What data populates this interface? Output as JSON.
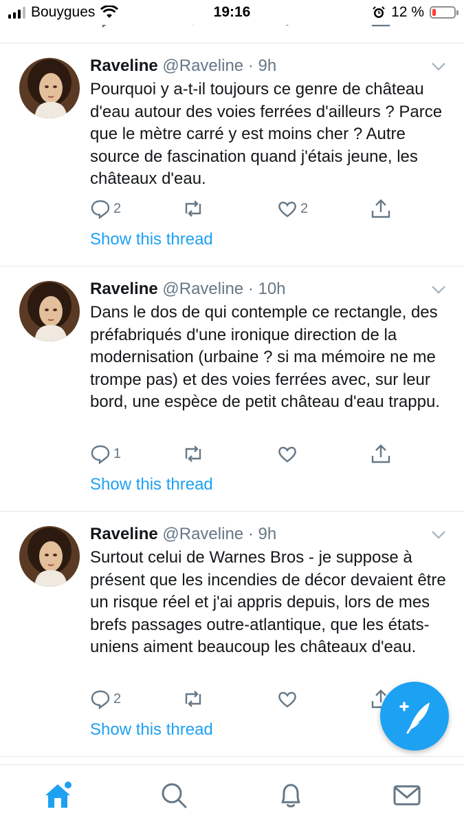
{
  "status_bar": {
    "carrier": "Bouygues",
    "time": "19:16",
    "battery": "12 %",
    "battery_level_percent": 12
  },
  "tweets": [
    {
      "name": "Raveline",
      "handle": "@Raveline",
      "time": "· 9h",
      "text": "Pourquoi y a-t-il toujours ce genre de château d'eau autour des voies ferrées d'ailleurs ? Parce que le mètre carré y est moins cher ? Autre source de fascination quand j'étais jeune, les châteaux d'eau.",
      "replies": "2",
      "retweets": "",
      "likes": "2",
      "thread_link": "Show this thread"
    },
    {
      "name": "Raveline",
      "handle": "@Raveline",
      "time": "· 10h",
      "text": "Dans le dos de qui contemple ce rectangle, des préfabriqués d'une ironique direction de la modernisation (urbaine ? si ma mémoire ne me trompe pas) et des voies ferrées avec, sur leur bord, une espèce de petit château d'eau trappu.",
      "replies": "1",
      "retweets": "",
      "likes": "",
      "thread_link": "Show this thread"
    },
    {
      "name": "Raveline",
      "handle": "@Raveline",
      "time": "· 9h",
      "text": "Surtout celui de Warnes Bros - je suppose à présent que les incendies de décor devaient être un risque réel et j'ai appris depuis, lors de mes brefs passages outre-atlantique, que les états-uniens aiment beaucoup les châteaux d'eau.",
      "replies": "2",
      "retweets": "",
      "likes": "",
      "thread_link": "Show this thread"
    }
  ],
  "icons": {
    "reply": "reply-icon",
    "retweet": "retweet-icon",
    "like": "heart-icon",
    "share": "share-icon",
    "caret": "chevron-down-icon",
    "compose": "compose-tweet-icon",
    "home": "home-icon",
    "search": "search-icon",
    "notifications": "bell-icon",
    "messages": "mail-icon"
  },
  "colors": {
    "accent": "#1da1f2",
    "text": "#14171a",
    "muted": "#657786",
    "divider": "#e1e8ed"
  }
}
